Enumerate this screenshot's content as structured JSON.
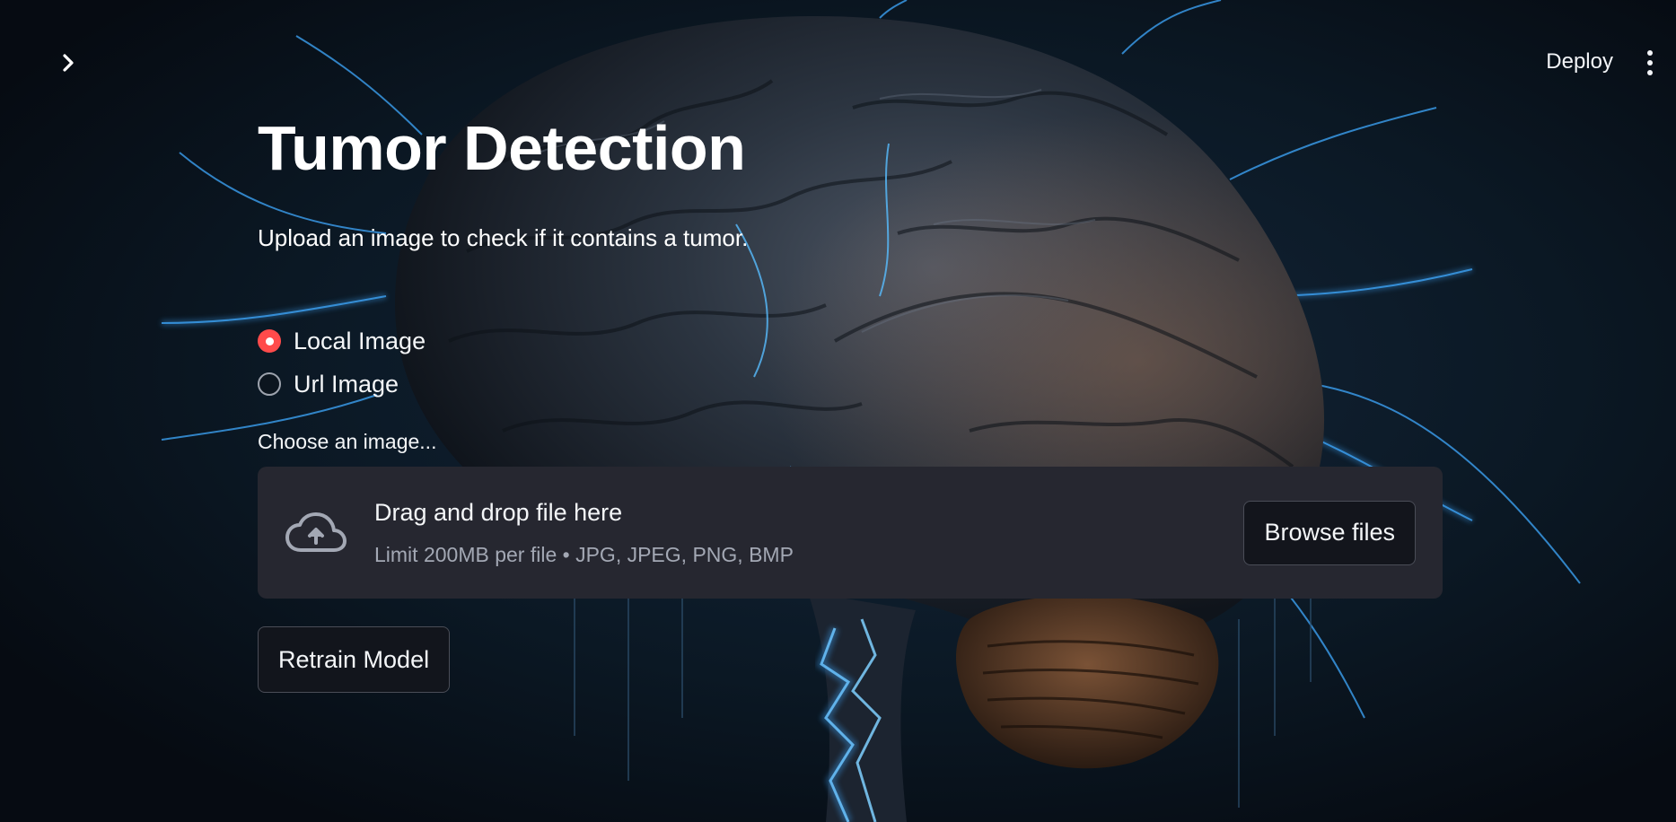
{
  "header": {
    "sidebar_toggle_icon": "chevron-right-icon",
    "deploy_label": "Deploy",
    "menu_icon": "vertical-ellipsis-icon"
  },
  "main": {
    "title": "Tumor Detection",
    "subtitle": "Upload an image to check if it contains a tumor.",
    "source_options": [
      {
        "label": "Local Image",
        "selected": true
      },
      {
        "label": "Url Image",
        "selected": false
      }
    ],
    "uploader": {
      "label": "Choose an image...",
      "icon": "cloud-upload-icon",
      "drop_text": "Drag and drop file here",
      "limit_text": "Limit 200MB per file • JPG, JPEG, PNG, BMP",
      "browse_label": "Browse files"
    },
    "retrain_label": "Retrain Model"
  },
  "colors": {
    "background": "#0b1623",
    "accent": "#ff4b4b",
    "dropzone": "#262730",
    "glow": "#3fb0ff"
  }
}
